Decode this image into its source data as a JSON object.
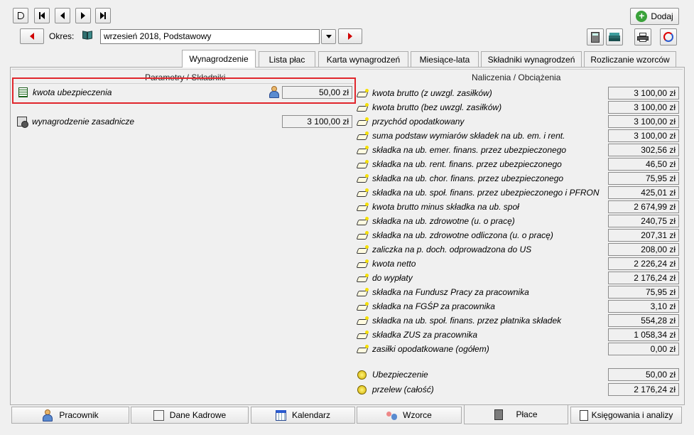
{
  "toolbar": {
    "okres_label": "Okres:",
    "okres_value": "wrzesień 2018, Podstawowy",
    "add_label": "Dodaj"
  },
  "tabs": [
    {
      "label": "Wynagrodzenie",
      "active": true
    },
    {
      "label": "Lista płac",
      "active": false
    },
    {
      "label": "Karta wynagrodzeń",
      "active": false
    },
    {
      "label": "Miesiące-lata",
      "active": false
    },
    {
      "label": "Składniki wynagrodzeń",
      "active": false
    },
    {
      "label": "Rozliczanie wzorców",
      "active": false
    }
  ],
  "left": {
    "heading": "Parametry / Składniki",
    "items": [
      {
        "label": "kwota ubezpieczenia",
        "value": "50,00 zł"
      },
      {
        "label": "wynagrodzenie zasadnicze",
        "value": "3 100,00 zł"
      }
    ]
  },
  "right": {
    "heading": "Naliczenia / Obciążenia",
    "items": [
      {
        "label": "kwota brutto (z uwzgl. zasiłków)",
        "value": "3 100,00 zł"
      },
      {
        "label": "kwota brutto (bez uwzgl. zasiłków)",
        "value": "3 100,00 zł"
      },
      {
        "label": "przychód opodatkowany",
        "value": "3 100,00 zł"
      },
      {
        "label": "suma podstaw wymiarów składek na ub. em. i rent.",
        "value": "3 100,00 zł"
      },
      {
        "label": "składka na ub. emer. finans. przez ubezpieczonego",
        "value": "302,56 zł"
      },
      {
        "label": "składka na ub. rent. finans. przez ubezpieczonego",
        "value": "46,50 zł"
      },
      {
        "label": "składka na ub. chor. finans. przez ubezpieczonego",
        "value": "75,95 zł"
      },
      {
        "label": "składka na ub. społ. finans. przez ubezpieczonego i PFRON",
        "value": "425,01 zł"
      },
      {
        "label": "kwota brutto minus składka na ub. społ",
        "value": "2 674,99 zł"
      },
      {
        "label": "składka na ub. zdrowotne (u. o pracę)",
        "value": "240,75 zł"
      },
      {
        "label": "składka na ub. zdrowotne odliczona (u. o pracę)",
        "value": "207,31 zł"
      },
      {
        "label": "zaliczka na p. doch. odprowadzona do US",
        "value": "208,00 zł"
      },
      {
        "label": "kwota netto",
        "value": "2 226,24 zł"
      },
      {
        "label": "do wypłaty",
        "value": "2 176,24 zł"
      },
      {
        "label": "składka na Fundusz Pracy za pracownika",
        "value": "75,95 zł"
      },
      {
        "label": "składka na FGŚP za pracownika",
        "value": "3,10 zł"
      },
      {
        "label": "składka na ub. społ. finans. przez płatnika składek",
        "value": "554,28 zł"
      },
      {
        "label": "składka ZUS za pracownika",
        "value": "1 058,34 zł"
      },
      {
        "label": "zasiłki opodatkowane (ogółem)",
        "value": "0,00 zł"
      }
    ],
    "extra": [
      {
        "label": "Ubezpieczenie",
        "value": "50,00 zł"
      },
      {
        "label": "przelew (całość)",
        "value": "2 176,24 zł"
      }
    ]
  },
  "bottom_tabs": [
    {
      "label": "Pracownik",
      "icon": "person-icon"
    },
    {
      "label": "Dane Kadrowe",
      "icon": "id-card-icon"
    },
    {
      "label": "Kalendarz",
      "icon": "calendar-icon"
    },
    {
      "label": "Wzorce",
      "icon": "people-icon"
    },
    {
      "label": "Płace",
      "icon": "calculator-icon"
    },
    {
      "label": "Księgowania i analizy",
      "icon": "ledger-icon"
    }
  ],
  "colors": {
    "highlight": "#e0262c",
    "accent_red": "#d00000",
    "add_green": "#3aa23a"
  }
}
